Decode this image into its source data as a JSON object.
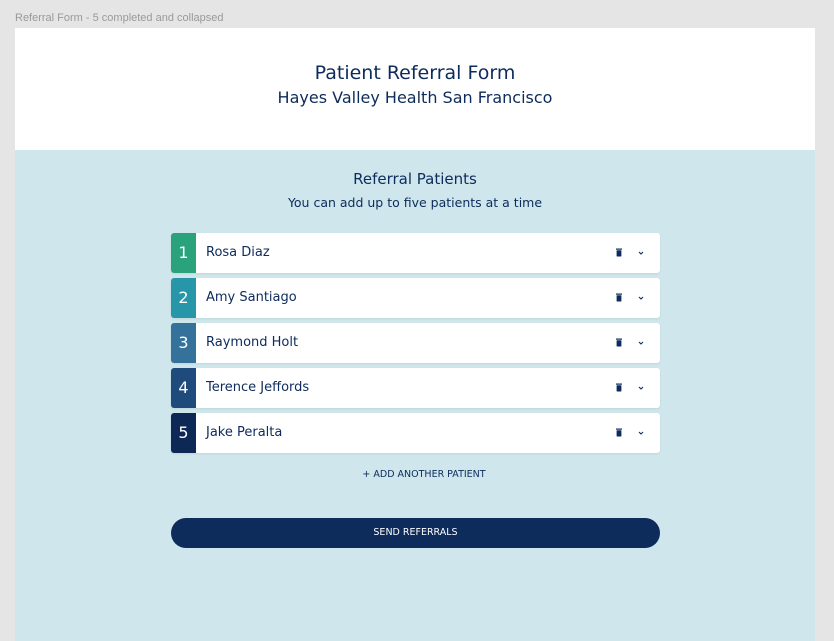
{
  "frame_label": "Referral Form - 5 completed and collapsed",
  "header": {
    "title": "Patient Referral Form",
    "subtitle": "Hayes Valley Health San Francisco"
  },
  "section": {
    "title": "Referral Patients",
    "subtitle": "You can add up to five patients at a time"
  },
  "patients": [
    {
      "number": "1",
      "name": "Rosa Diaz",
      "color": "#2aa37c"
    },
    {
      "number": "2",
      "name": "Amy Santiago",
      "color": "#2796a8"
    },
    {
      "number": "3",
      "name": "Raymond Holt",
      "color": "#35729b"
    },
    {
      "number": "4",
      "name": "Terence Jeffords",
      "color": "#1f4b7c"
    },
    {
      "number": "5",
      "name": "Jake Peralta",
      "color": "#0e2855"
    }
  ],
  "row_icons": {
    "delete": "trash-icon",
    "expand": "chevron-down-icon"
  },
  "add_patient_label": "+ ADD ANOTHER PATIENT",
  "send_button_label": "SEND REFERRALS",
  "colors": {
    "navy": "#0d2b5b",
    "background": "#cfe7ec",
    "header_bg": "#ffffff"
  }
}
